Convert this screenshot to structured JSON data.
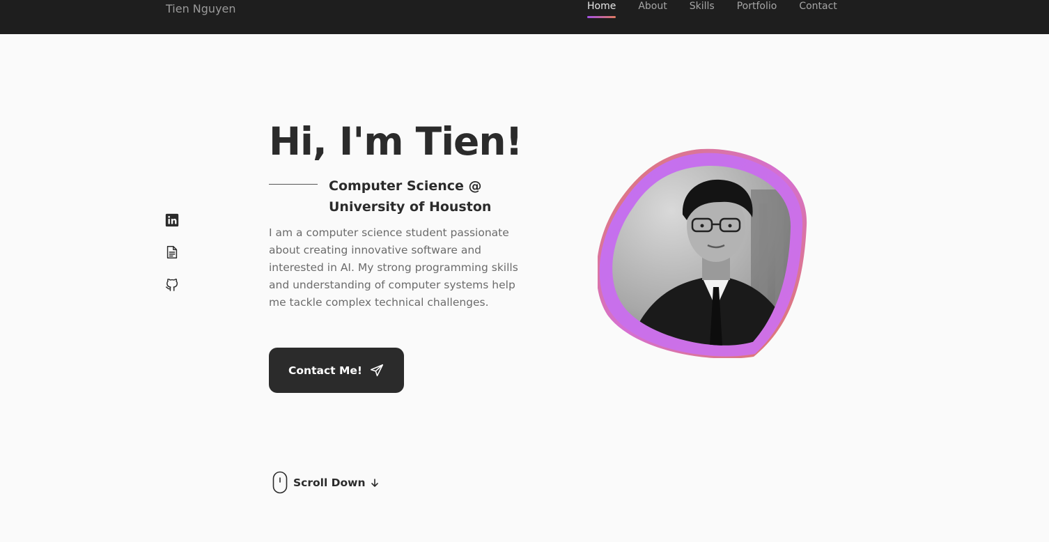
{
  "header": {
    "brand": "Tien Nguyen",
    "nav": [
      {
        "label": "Home",
        "active": true
      },
      {
        "label": "About"
      },
      {
        "label": "Skills"
      },
      {
        "label": "Portfolio"
      },
      {
        "label": "Contact"
      }
    ]
  },
  "social": [
    {
      "icon": "linkedin-icon"
    },
    {
      "icon": "resume-icon"
    },
    {
      "icon": "github-icon"
    }
  ],
  "hero": {
    "title": "Hi, I'm Tien!",
    "subtitle": "Computer Science @ University of Houston",
    "description": "I am a computer science student passionate about creating innovative software and interested in AI. My strong programming skills and understanding of computer systems help me tackle complex technical challenges.",
    "cta_label": "Contact Me!",
    "cta_icon": "send-icon"
  },
  "scroll": {
    "label": "Scroll Down",
    "icon": "mouse-icon",
    "arrow_icon": "arrow-down-icon"
  },
  "colors": {
    "nav_bg": "#1e1e1e",
    "page_bg": "#fafafa",
    "text": "#2b2b2b",
    "accent_purple": "#c46ff0",
    "accent_coral": "#e07a5f"
  }
}
